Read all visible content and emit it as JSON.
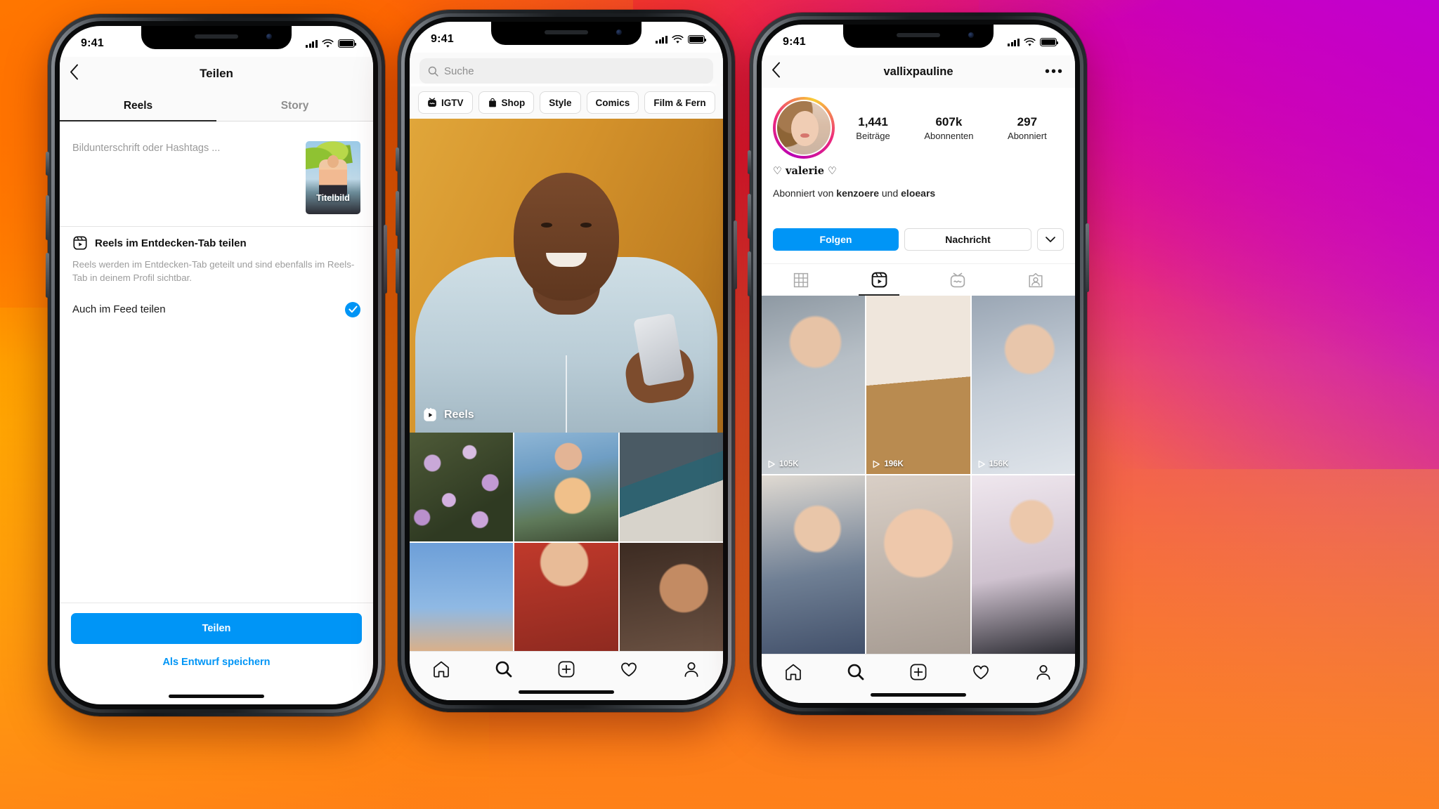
{
  "background": {
    "gradient_from": "#ff7a00",
    "gradient_mid": "#ff0000",
    "gradient_to": "#cc00d6"
  },
  "status_bar": {
    "time": "9:41"
  },
  "phone1": {
    "nav": {
      "back_icon": "chevron-left-icon",
      "title": "Teilen"
    },
    "tabs": [
      {
        "label": "Reels",
        "active": true
      },
      {
        "label": "Story",
        "active": false
      }
    ],
    "caption": {
      "placeholder": "Bildunterschrift oder Hashtags ...",
      "thumbnail_label": "Titelbild"
    },
    "section": {
      "icon": "reels-icon",
      "title": "Reels im Entdecken-Tab teilen",
      "body": "Reels werden im Entdecken-Tab geteilt und sind ebenfalls im Reels-Tab in deinem Profil sichtbar."
    },
    "feed_row": {
      "label": "Auch im Feed teilen",
      "checked": true,
      "check_color": "#0095f6"
    },
    "primary_button": {
      "label": "Teilen",
      "color": "#0095f6"
    },
    "secondary_button": {
      "label": "Als Entwurf speichern",
      "color": "#0095f6"
    }
  },
  "phone2": {
    "search": {
      "placeholder": "Suche",
      "icon": "search-icon"
    },
    "chips": [
      {
        "label": "IGTV",
        "icon": "igtv-icon"
      },
      {
        "label": "Shop",
        "icon": "shop-bag-icon"
      },
      {
        "label": "Style",
        "icon": ""
      },
      {
        "label": "Comics",
        "icon": ""
      },
      {
        "label": "Film & Fern",
        "icon": ""
      }
    ],
    "hero": {
      "badge_label": "Reels",
      "badge_icon": "reels-icon"
    },
    "grid_cells": [
      "lilac-flowers",
      "mother-child-swing",
      "skateboard-crosswalk",
      "hand-blue-sky",
      "child-red-hoodie",
      "child-curly-hair"
    ],
    "tabbar": [
      {
        "icon": "home-icon",
        "active": false
      },
      {
        "icon": "search-icon",
        "active": true
      },
      {
        "icon": "plus-square-icon",
        "active": false
      },
      {
        "icon": "heart-icon",
        "active": false
      },
      {
        "icon": "person-icon",
        "active": false
      }
    ]
  },
  "phone3": {
    "nav": {
      "back_icon": "chevron-left-icon",
      "username": "vallixpauline",
      "menu_icon": "more-options-icon"
    },
    "avatar": {
      "name": "avatar",
      "has_story_ring": true
    },
    "stats": [
      {
        "value": "1,441",
        "label": "Beiträge"
      },
      {
        "value": "607k",
        "label": "Abonnenten"
      },
      {
        "value": "297",
        "label": "Abonniert"
      }
    ],
    "bio": {
      "display_name": "♡ valerie ♡"
    },
    "followed_by": {
      "prefix": "Abonniert von ",
      "user1": "kenzoere",
      "middle": " und ",
      "user2": "eloears"
    },
    "actions": {
      "follow_label": "Folgen",
      "follow_color": "#0095f6",
      "message_label": "Nachricht",
      "caret_icon": "chevron-down-icon"
    },
    "tabs": [
      {
        "icon": "grid-icon",
        "active": false
      },
      {
        "icon": "reels-icon",
        "active": true
      },
      {
        "icon": "igtv-icon",
        "active": false
      },
      {
        "icon": "tagged-person-icon",
        "active": false
      }
    ],
    "reels": [
      {
        "plays": "105K",
        "icon": "play-icon"
      },
      {
        "plays": "196K",
        "icon": "play-icon"
      },
      {
        "plays": "156K",
        "icon": "play-icon"
      },
      {
        "plays": "",
        "icon": "play-icon"
      },
      {
        "plays": "",
        "icon": "play-icon"
      },
      {
        "plays": "",
        "icon": "play-icon"
      }
    ],
    "tabbar": [
      {
        "icon": "home-icon",
        "active": false
      },
      {
        "icon": "search-icon",
        "active": false
      },
      {
        "icon": "plus-square-icon",
        "active": false
      },
      {
        "icon": "heart-icon",
        "active": false
      },
      {
        "icon": "person-icon",
        "active": true
      }
    ]
  }
}
